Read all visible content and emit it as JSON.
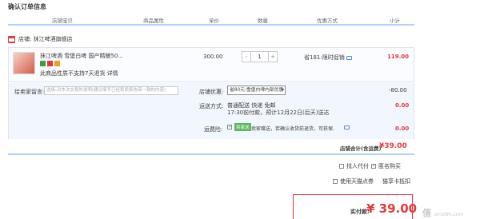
{
  "page": {
    "title": "确认订单信息"
  },
  "table_headers": [
    "店铺宝贝",
    "商品属性",
    "单价",
    "数量",
    "优惠方式",
    "小计"
  ],
  "shop": {
    "label": "店铺: 抹江啤酒旗舰店"
  },
  "item": {
    "title": "抹江啤酒 雪堡白啤 国产精酿50...",
    "note": "此商品性质不支持7天退货 详情",
    "price": "300.00",
    "quantity": "1",
    "qty_minus": "-",
    "qty_plus": "+",
    "discount": "省181:限时促销",
    "subtotal": "119.00"
  },
  "options": {
    "message_label": "给卖家留言:",
    "message_placeholder": "选填:对本次交易的说明(建议填写已经和卖家协商一致的内容)",
    "shipping_label": "店铺优惠:",
    "shipping_selected": "省80元:雪堡白啤内部优惠",
    "shipping_amount": "-80.00",
    "delivery_label": "运送方式:",
    "delivery_line1": "普通配送 快递 免邮",
    "delivery_line2": "17:30前付款，预计12月22日(后天)送达",
    "delivery_amount": "0.00",
    "insurance_label": "运费险:",
    "insurance_tag": "卖家送",
    "insurance_text": "卖家赠送，若确认收货前退货，可获保...",
    "insurance_amount": "0.00"
  },
  "shop_total": {
    "label": "店铺合计(含运费)",
    "value": "¥39.00"
  },
  "checkout_options": {
    "anonymous": "找人代付",
    "anonymous_buy": "匿名购买",
    "tmall_points": "使用天猫点券",
    "tmall_card": "猫享卡抵扣"
  },
  "payment": {
    "label": "实付款:",
    "value": "¥ 39.00"
  },
  "watermark": {
    "text": "值",
    "sub": "smzdm.com"
  }
}
